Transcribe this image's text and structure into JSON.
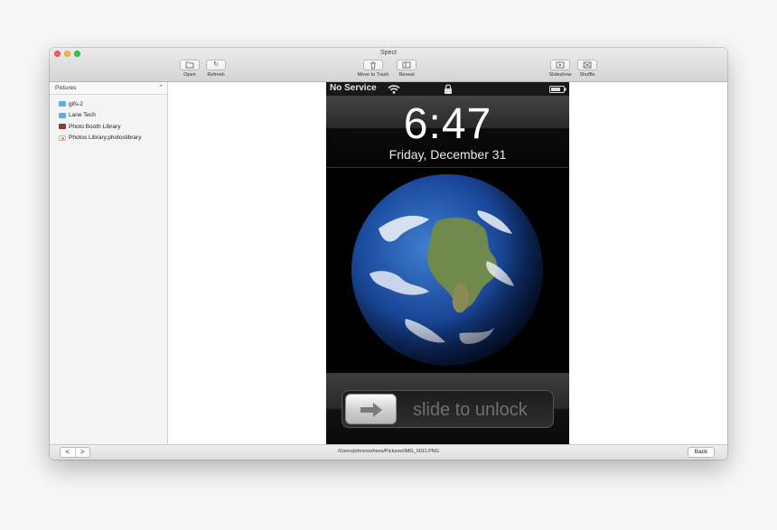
{
  "window": {
    "title": "Spect"
  },
  "toolbar": {
    "open_label": "Open",
    "refresh_label": "Refresh",
    "trash_label": "Move to Trash",
    "reveal_label": "Reveal",
    "slideshow_label": "Slideshow",
    "shuffle_label": "Shuffle"
  },
  "sidebar": {
    "location": "Pictures",
    "items": [
      {
        "label": "gifs-2",
        "icon": "folder-icon"
      },
      {
        "label": "Lane Tech",
        "icon": "folder-icon"
      },
      {
        "label": "Photo Booth Library",
        "icon": "photo-booth-icon"
      },
      {
        "label": "Photos Library.photoslibrary",
        "icon": "photos-icon"
      }
    ]
  },
  "image": {
    "carrier": "No Service",
    "time": "6:47",
    "date": "Friday, December 31",
    "slide_text": "slide to unlock"
  },
  "bottom": {
    "prev_symbol": "<",
    "next_symbol": ">",
    "path": "/Users/johnvoorhees/Pictures/IMG_0011.PNG",
    "back_label": "Back"
  }
}
